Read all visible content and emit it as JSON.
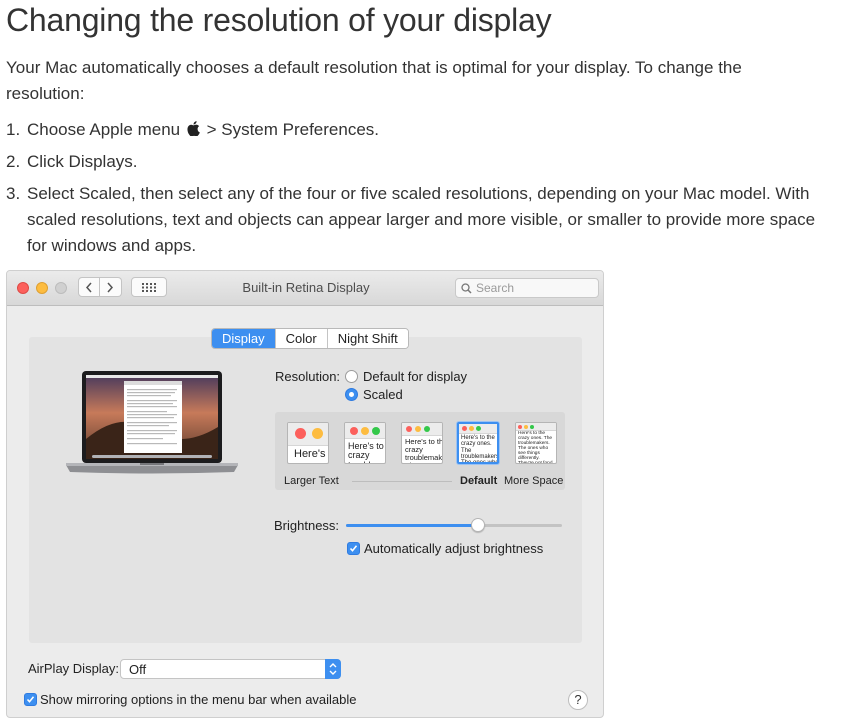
{
  "article": {
    "title": "Changing the resolution of your display",
    "intro": "Your Mac automatically chooses a default resolution that is optimal for your display. To change the resolution:",
    "steps": [
      {
        "number": "1.",
        "before": "Choose Apple menu",
        "after": "> System Preferences."
      },
      {
        "number": "2.",
        "text": "Click Displays."
      },
      {
        "number": "3.",
        "text": "Select Scaled, then select any of the four or five scaled resolutions, depending on your Mac model. With scaled resolutions, text and objects can appear larger and more visible, or smaller to provide more space for windows and apps."
      }
    ]
  },
  "window": {
    "title": "Built-in Retina Display",
    "search_placeholder": "Search",
    "tabs": [
      "Display",
      "Color",
      "Night Shift"
    ],
    "active_tab": "Display",
    "resolution": {
      "label": "Resolution:",
      "options": [
        "Default for display",
        "Scaled"
      ],
      "selected": "Scaled"
    },
    "scaled": {
      "thumbnail_texts": [
        "Here's",
        "Here's to the crazy troublemakers.",
        "Here's to the crazy troublemakers. The ones who see things",
        "Here's to the crazy ones. The troublemakers. The ones who see things differently. They're not fond of rules. And they",
        "Here's to the crazy ones. The troublemakers. The ones who see things differently. They're not fond of rules. And they have no respect for the status quo. You can quote them, disagree with them, glorify or vilify them. Because they change"
      ],
      "selected_index": 3,
      "left_label": "Larger Text",
      "default_label": "Default",
      "right_label": "More Space"
    },
    "brightness": {
      "label": "Brightness:",
      "level": 0.61,
      "auto_label": "Automatically adjust brightness",
      "auto_checked": true
    },
    "airplay": {
      "label": "AirPlay Display:",
      "value": "Off"
    },
    "mirroring": {
      "label": "Show mirroring options in the menu bar when available",
      "checked": true
    },
    "help_label": "?"
  },
  "colors": {
    "accent": "#3d8ff0",
    "close": "#fc605c",
    "minimize": "#fdbc40"
  }
}
